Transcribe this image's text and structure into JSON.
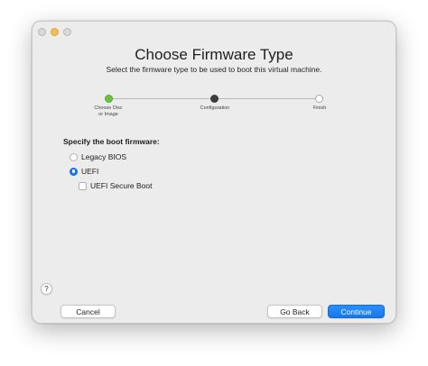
{
  "dialog": {
    "title": "Choose Firmware Type",
    "subtitle": "Select the firmware type to be used to boot this virtual machine."
  },
  "steps": [
    {
      "label": "Choose Disc\nor Image",
      "state": "done"
    },
    {
      "label": "Configuration",
      "state": "current"
    },
    {
      "label": "Finish",
      "state": "todo"
    }
  ],
  "firmware": {
    "section_label": "Specify the boot firmware:",
    "options": [
      {
        "label": "Legacy BIOS",
        "selected": false
      },
      {
        "label": "UEFI",
        "selected": true
      }
    ],
    "secure_boot_label": "UEFI Secure Boot",
    "secure_boot_checked": false
  },
  "footer": {
    "help_label": "?",
    "cancel_label": "Cancel",
    "back_label": "Go Back",
    "continue_label": "Continue"
  },
  "colors": {
    "accent": "#1678f0",
    "step_done": "#6dc33f",
    "step_current": "#3c3c3c"
  }
}
